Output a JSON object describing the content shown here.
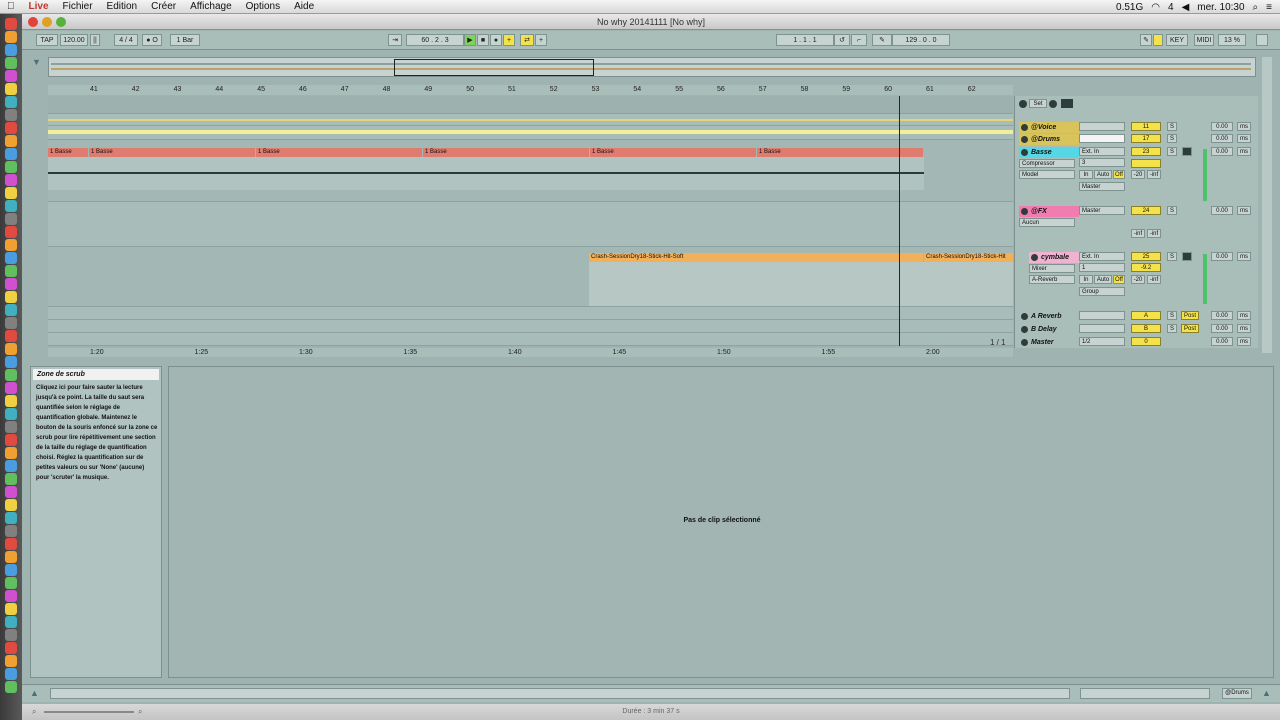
{
  "menubar": {
    "apple": "",
    "app": "Live",
    "items": [
      "Fichier",
      "Edition",
      "Créer",
      "Affichage",
      "Options",
      "Aide"
    ],
    "status": {
      "cpu": "0.51G",
      "battery": "4",
      "time": "mer. 10:30"
    }
  },
  "window": {
    "title": "No why 20141111  [No why]"
  },
  "transport": {
    "tap": "TAP",
    "tempo": "120.00",
    "signature": "4 / 4",
    "metronome": "● O",
    "quantize": "1 Bar",
    "position": "60 .  2 .  3",
    "loop_start": "1 .  1 .  1",
    "loop_length": "129 .  0 .  0",
    "key": "KEY",
    "midi": "MIDI",
    "cpu": "13 %"
  },
  "ruler": {
    "bars": [
      "41",
      "42",
      "43",
      "44",
      "45",
      "46",
      "47",
      "48",
      "49",
      "50",
      "51",
      "52",
      "53",
      "54",
      "55",
      "56",
      "57",
      "58",
      "59",
      "60",
      "61",
      "62"
    ]
  },
  "timeruler": {
    "times": [
      "1:20",
      "1:25",
      "1:30",
      "1:35",
      "1:40",
      "1:45",
      "1:50",
      "1:55",
      "2:00"
    ],
    "page": "1 / 1"
  },
  "mixer_header": {
    "set": "Set"
  },
  "tracks": [
    {
      "name": "@Voice",
      "input": "",
      "ctrl": "",
      "num": "11",
      "vol": "0.00",
      "pan": "ms",
      "color": "#d8c45a"
    },
    {
      "name": "@Drums",
      "input": "",
      "ctrl": "",
      "num": "17",
      "vol": "0.00",
      "pan": "ms",
      "color": "#d8c45a"
    },
    {
      "name": "Basse",
      "input": "Ext. In",
      "ctrl": "Compressor",
      "sub": "Model",
      "num": "23",
      "vol": "0.00",
      "pan": "ms",
      "color": "#56d7e5",
      "monitor": [
        "In",
        "Auto",
        "Off"
      ],
      "send": "-20",
      "inf": "-inf",
      "out": "Master",
      "ch": "3"
    },
    {
      "name": "@FX",
      "input": "Master",
      "ctrl": "Aucun",
      "num": "24",
      "vol": "0.00",
      "pan": "ms",
      "color": "#f07cb0",
      "inf1": "-inf",
      "inf2": "-inf"
    },
    {
      "name": "cymbale",
      "input": "Ext. In",
      "ctrl": "Mixer",
      "sub": "A-Reverb",
      "num": "25",
      "vol": "0.00",
      "pan": "ms",
      "color": "#f0b2d1",
      "monitor": [
        "In",
        "Auto",
        "Off"
      ],
      "send": "-20",
      "inf": "-inf",
      "gain": "-9.2",
      "out": "Group",
      "ch": "1"
    },
    {
      "name": "A Reverb",
      "num": "A",
      "vol": "0.00",
      "pan": "ms",
      "post": "Post"
    },
    {
      "name": "B Delay",
      "num": "B",
      "vol": "0.00",
      "pan": "ms",
      "post": "Post"
    },
    {
      "name": "Master",
      "input": "1/2",
      "num": "0",
      "vol": "0.00",
      "pan": "ms"
    }
  ],
  "clips": {
    "basse": [
      "1 Basse",
      "1 Basse",
      "1 Basse",
      "1 Basse",
      "1 Basse",
      "1 Basse"
    ],
    "crash": [
      "Crash-SessionDry18-Stick-Hit-Soft",
      "Crash-SessionDry18-Stick-Hit"
    ]
  },
  "info": {
    "title": "Zone de scrub",
    "body": "Cliquez ici pour faire sauter la lecture jusqu'à ce point. La taille du saut sera quantifiée selon le réglage de quantification globale. Maintenez le bouton de la souris enfoncé sur la zone ce scrub pour lire répétitivement une section de la taille du réglage de quantification choisi. Réglez la quantification sur de petites valeurs ou sur 'None' (aucune) pour 'scruter' la musique."
  },
  "detail": {
    "message": "Pas de clip sélectionné"
  },
  "bottombar": {
    "track": "@Drums"
  },
  "footer": {
    "duration": "Durée : 3 min 37 s"
  }
}
